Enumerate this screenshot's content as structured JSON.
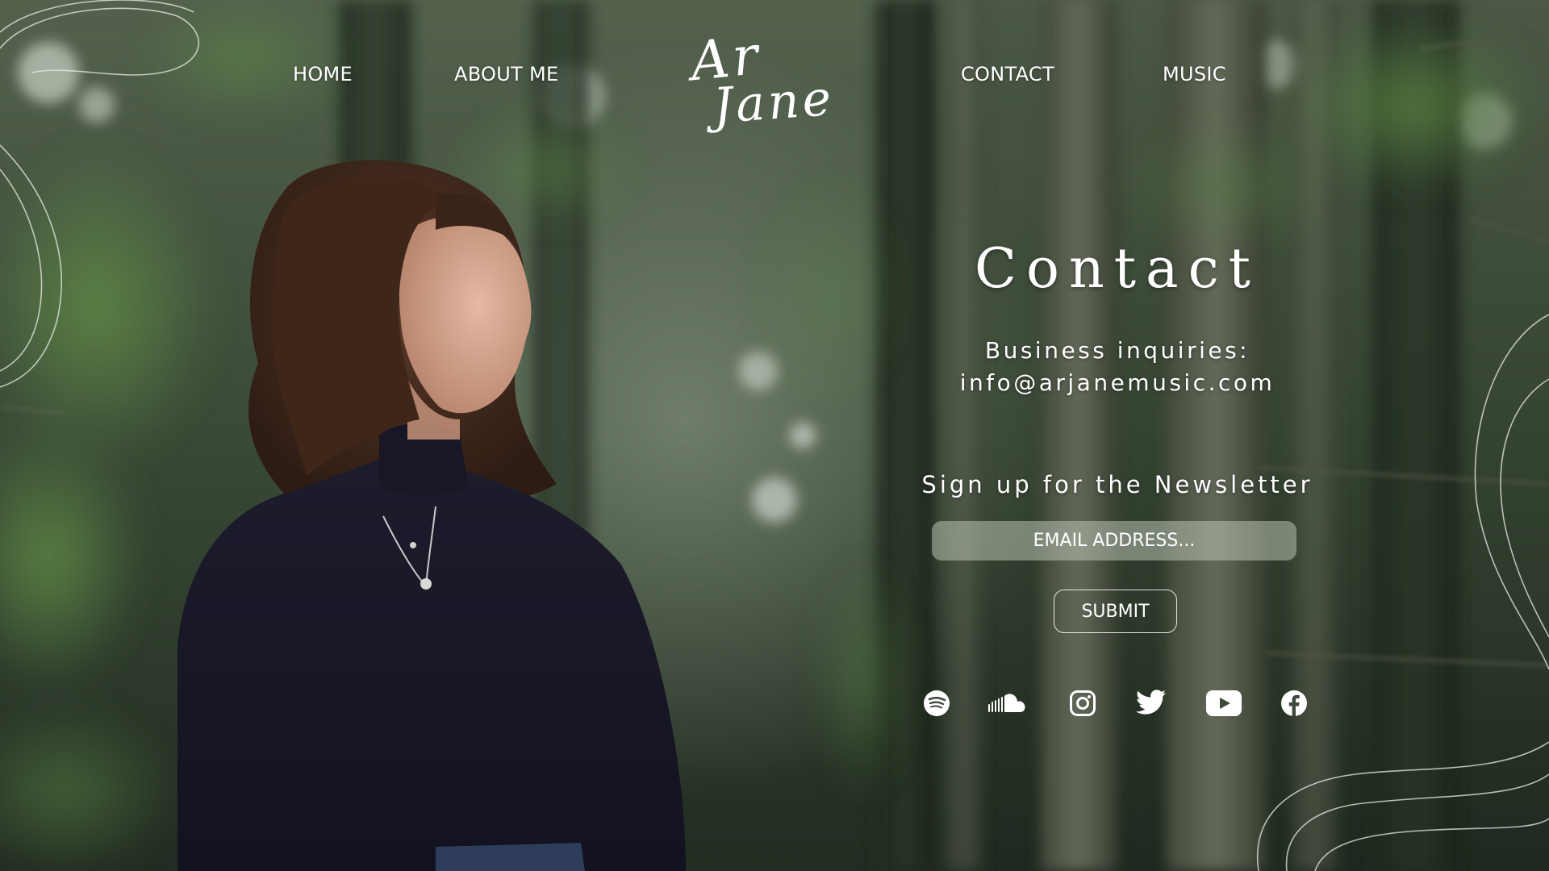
{
  "nav": {
    "home": "HOME",
    "about": "ABOUT ME",
    "contact": "CONTACT",
    "music": "MUSIC"
  },
  "logo": {
    "line1": "Ar",
    "line2": "Jane"
  },
  "contact": {
    "title": "Contact",
    "inquiries_label": "Business inquiries:",
    "inquiries_email": "info@arjanemusic.com"
  },
  "newsletter": {
    "heading": "Sign up for the Newsletter",
    "email_placeholder": "EMAIL ADDRESS...",
    "submit_label": "SUBMIT"
  },
  "social": [
    "spotify-icon",
    "soundcloud-icon",
    "instagram-icon",
    "twitter-icon",
    "youtube-icon",
    "facebook-icon"
  ],
  "colors": {
    "text": "#ffffff",
    "forest_dark": "#1d261d",
    "foliage": "#4d6a3f",
    "sweater": "#1a1a2a",
    "hair": "#4a2c1f",
    "input_fill": "#bec8b8"
  }
}
